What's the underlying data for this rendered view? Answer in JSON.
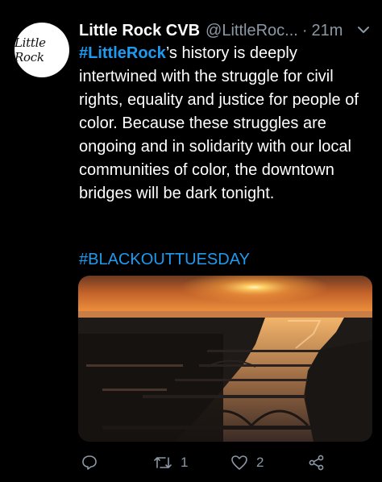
{
  "account": {
    "avatar_text": "Little Rock",
    "display_name": "Little Rock CVB",
    "handle": "@LittleRoc...",
    "separator": "·",
    "time": "21m"
  },
  "tweet": {
    "hashtag_lead": "#LittleRock",
    "text": "’s history is deeply intertwined with the struggle for civil rights, equality and justice for people of color. Because these struggles are ongoing and in solidarity with our local communities of color, the downtown bridges will be dark tonight.",
    "hashtag_tail": "#BLACKOUTTUESDAY"
  },
  "actions": {
    "reply_count": "",
    "retweet_count": "1",
    "like_count": "2"
  },
  "icons": [
    "caret-down-icon",
    "reply-icon",
    "retweet-icon",
    "like-icon",
    "share-icon"
  ],
  "colors": {
    "background": "#000000",
    "link": "#1d9bf0",
    "secondary_text": "#8b98a5"
  }
}
